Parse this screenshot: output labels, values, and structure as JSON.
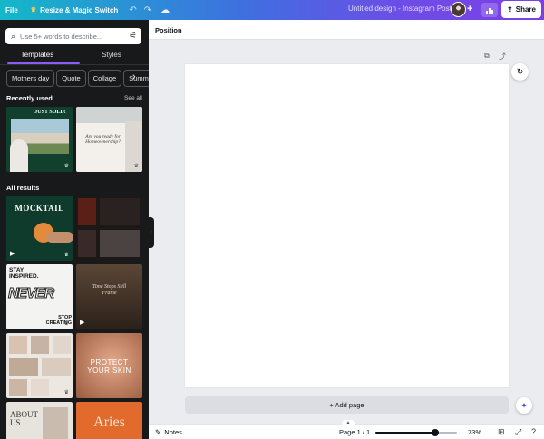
{
  "topbar": {
    "file": "File",
    "resize": "Resize & Magic Switch",
    "title": "Untitled design - Instagram Post",
    "share": "Share"
  },
  "panel": {
    "search_placeholder": "Use 5+ words to describe...",
    "tabs": [
      "Templates",
      "Styles"
    ],
    "chips": [
      "Mothers day",
      "Quote",
      "Collage",
      "Summ"
    ],
    "recently_used": "Recently used",
    "see_all": "See all",
    "all_results": "All results",
    "thumbs": {
      "just_sold": "JUST SOLD!",
      "homeownership": "Are you ready for Homeownership?",
      "mocktail": "MOCKTAIL",
      "stay_inspired": "STAY INSPIRED.",
      "never": "NEVER",
      "stop_create": "STOP CREATING",
      "time_stops": "Time Stops Still Frame",
      "protect": "PROTECT YOUR SKIN",
      "about": "ABOUT US",
      "aries": "Aries"
    }
  },
  "canvas": {
    "position_label": "Position",
    "add_page": "+ Add page"
  },
  "bottombar": {
    "notes": "Notes",
    "page_info": "Page 1 / 1",
    "zoom": "73%",
    "zoom_fraction": 0.73
  },
  "icons": {
    "crown": "crown-icon",
    "undo": "undo-icon",
    "redo": "redo-icon",
    "cloud": "cloud-icon",
    "search": "search-icon",
    "filter": "filter-icon"
  },
  "colors": {
    "accent": "#8b5cf6",
    "panel_bg": "#18191b",
    "canvas_bg": "#ebecf0"
  }
}
